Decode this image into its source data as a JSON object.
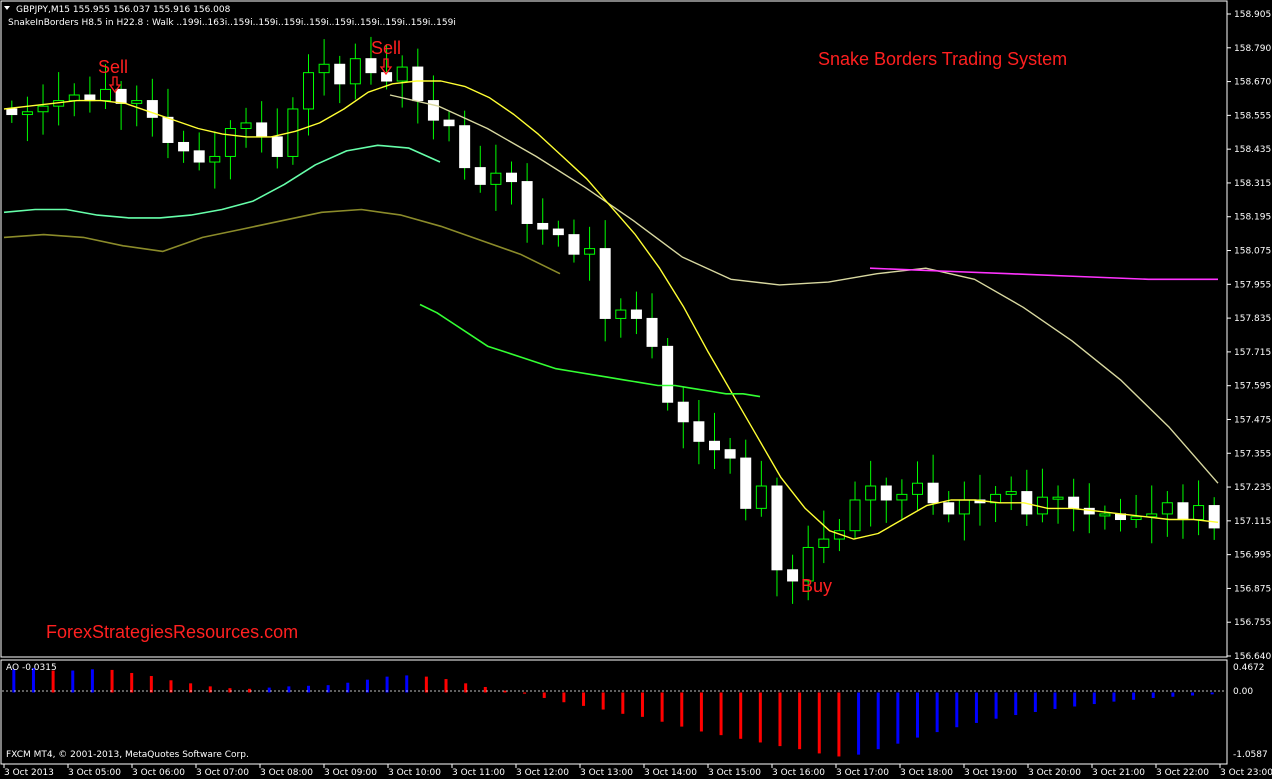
{
  "colors": {
    "background": "#000000",
    "frame": "#ffffff",
    "candle_up_body": "#000000",
    "candle_up_border": "#00ff00",
    "candle_down_body": "#ffffff",
    "wick": "#00ff00",
    "fast_ma": "#ffff33",
    "fast_ma_white": "#ffffcc",
    "snake_green": "#66ff66",
    "snake_lime": "#33ff33",
    "border_teal": "#66ffaa",
    "border_olive": "#8b8b2a",
    "slow_ma": "#d8d8a0",
    "slow_ma_magenta": "#ff33ff",
    "ao_red": "#ff0000",
    "ao_blue": "#0000ff",
    "annotation": "#ff2020"
  },
  "header": {
    "symbol_line": "GBPJPY,M15  155.955 156.037 155.916 156.008",
    "indicator_line": "SnakeInBorders H8.5 in H22.8 :   Walk ..199i..163i..159i..159i..159i..159i..159i..159i..159i..159i..159i"
  },
  "annotations": {
    "title": "Snake Borders Trading System",
    "sell_1": "Sell",
    "sell_2": "Sell",
    "buy": "Buy",
    "website": "ForexStrategiesResources.com",
    "sell_arrow_icon": "down-arrow-icon"
  },
  "ao_panel": {
    "label": "AO -0.0315",
    "ticks": [
      "0.4672",
      "0.00",
      "-1.0587"
    ]
  },
  "footer": {
    "copyright": "FXCM MT4, © 2001-2013, MetaQuotes Software Corp."
  },
  "chart_data": {
    "type": "candlestick",
    "symbol": "GBPJPY",
    "timeframe": "M15",
    "ylim": [
      156.64,
      158.91
    ],
    "price_ticks": [
      "158.905",
      "158.790",
      "158.670",
      "158.555",
      "158.435",
      "158.315",
      "158.195",
      "158.075",
      "157.955",
      "157.835",
      "157.715",
      "157.595",
      "157.475",
      "157.355",
      "157.235",
      "157.115",
      "156.995",
      "156.875",
      "156.755",
      "156.640"
    ],
    "time_ticks": [
      "3 Oct 2013",
      "3 Oct 05:00",
      "3 Oct 06:00",
      "3 Oct 07:00",
      "3 Oct 08:00",
      "3 Oct 09:00",
      "3 Oct 10:00",
      "3 Oct 11:00",
      "3 Oct 12:00",
      "3 Oct 13:00",
      "3 Oct 14:00",
      "3 Oct 15:00",
      "3 Oct 16:00",
      "3 Oct 17:00",
      "3 Oct 18:00",
      "3 Oct 19:00",
      "3 Oct 20:00",
      "3 Oct 21:00",
      "3 Oct 22:00",
      "3 Oct 23:00"
    ],
    "closes": [
      158.55,
      158.56,
      158.58,
      158.6,
      158.62,
      158.6,
      158.64,
      158.59,
      158.6,
      158.54,
      158.45,
      158.42,
      158.38,
      158.4,
      158.5,
      158.52,
      158.47,
      158.4,
      158.57,
      158.7,
      158.73,
      158.66,
      158.75,
      158.7,
      158.67,
      158.72,
      158.6,
      158.53,
      158.51,
      158.36,
      158.3,
      158.34,
      158.31,
      158.16,
      158.14,
      158.12,
      158.05,
      158.07,
      157.82,
      157.85,
      157.82,
      157.72,
      157.52,
      157.45,
      157.38,
      157.35,
      157.32,
      157.14,
      157.22,
      156.92,
      156.88,
      157.0,
      157.03,
      157.06,
      157.17,
      157.22,
      157.17,
      157.19,
      157.23,
      157.16,
      157.12,
      157.17,
      157.16,
      157.19,
      157.2,
      157.12,
      157.18,
      157.18,
      157.14,
      157.12,
      157.12,
      157.1,
      157.11,
      157.12,
      157.16,
      157.1,
      157.15,
      157.07
    ],
    "fast_ma": [
      158.57,
      158.58,
      158.59,
      158.6,
      158.6,
      158.59,
      158.56,
      158.53,
      158.5,
      158.48,
      158.47,
      158.47,
      158.49,
      158.52,
      158.57,
      158.63,
      158.66,
      158.67,
      158.67,
      158.65,
      158.61,
      158.55,
      158.48,
      158.4,
      158.32,
      158.22,
      158.12,
      158.0,
      157.86,
      157.7,
      157.55,
      157.4,
      157.25,
      157.14,
      157.06,
      157.03,
      157.05,
      157.1,
      157.15,
      157.17,
      157.17,
      157.16,
      157.16,
      157.14,
      157.14,
      157.13,
      157.12,
      157.11,
      157.1,
      157.1,
      157.09
    ],
    "snake": [
      157.87,
      157.84,
      157.8,
      157.76,
      157.72,
      157.7,
      157.68,
      157.66,
      157.64,
      157.63,
      157.62,
      157.61,
      157.6,
      157.59,
      157.58,
      157.58,
      157.57,
      157.56,
      157.55,
      157.55,
      157.54
    ],
    "border_teal": [
      158.2,
      158.21,
      158.21,
      158.19,
      158.18,
      158.18,
      158.19,
      158.21,
      158.24,
      158.3,
      158.37,
      158.42,
      158.44,
      158.43,
      158.38
    ],
    "border_olive": [
      158.11,
      158.12,
      158.11,
      158.08,
      158.06,
      158.11,
      158.14,
      158.17,
      158.2,
      158.21,
      158.19,
      158.15,
      158.1,
      158.05,
      157.98
    ],
    "slow_ma": [
      158.62,
      158.58,
      158.5,
      158.4,
      158.29,
      158.17,
      158.04,
      157.96,
      157.94,
      157.95,
      157.98,
      158.0,
      157.96,
      157.86,
      157.74,
      157.6,
      157.43,
      157.23
    ],
    "slow_ma_magenta": [
      158.0,
      157.99,
      157.98,
      157.97,
      157.96,
      157.96
    ],
    "ao": [
      0.38,
      0.4,
      0.36,
      0.36,
      0.38,
      0.37,
      0.32,
      0.27,
      0.2,
      0.15,
      0.1,
      0.07,
      0.06,
      0.08,
      0.1,
      0.11,
      0.12,
      0.16,
      0.21,
      0.26,
      0.28,
      0.26,
      0.22,
      0.15,
      0.09,
      0.03,
      -0.02,
      -0.09,
      -0.16,
      -0.22,
      -0.28,
      -0.35,
      -0.4,
      -0.48,
      -0.56,
      -0.64,
      -0.7,
      -0.76,
      -0.82,
      -0.88,
      -0.93,
      -1.0,
      -1.05,
      -1.02,
      -0.93,
      -0.84,
      -0.74,
      -0.65,
      -0.57,
      -0.5,
      -0.43,
      -0.37,
      -0.32,
      -0.27,
      -0.23,
      -0.19,
      -0.15,
      -0.12,
      -0.09,
      -0.07,
      -0.05,
      -0.03
    ],
    "ao_range": [
      -1.0587,
      0.4672
    ]
  }
}
